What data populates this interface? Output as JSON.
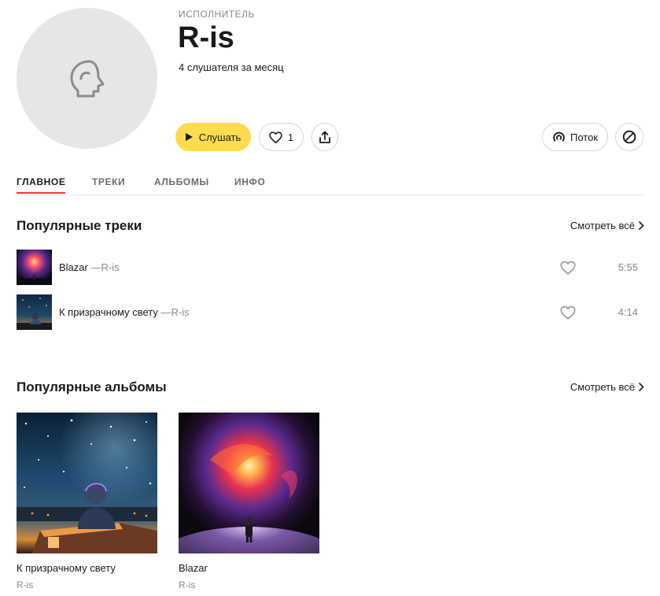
{
  "artist": {
    "kind": "ИСПОЛНИТЕЛЬ",
    "name": "R-is",
    "listeners": "4 слушателя за месяц",
    "avatar_icon": "artist-placeholder-icon"
  },
  "actions": {
    "play_label": "Слушать",
    "like_count": "1",
    "wave_label": "Поток",
    "accent_color": "#ffdb4d"
  },
  "tabs": [
    {
      "label": "ГЛАВНОЕ",
      "active": true
    },
    {
      "label": "ТРЕКИ",
      "active": false
    },
    {
      "label": "АЛЬБОМЫ",
      "active": false
    },
    {
      "label": "ИНФО",
      "active": false
    }
  ],
  "popular_tracks": {
    "title": "Популярные треки",
    "see_all": "Смотреть всё",
    "items": [
      {
        "title": "Blazar",
        "separator": "—",
        "artist": "R-is",
        "duration": "5:55"
      },
      {
        "title": "К призрачному свету",
        "separator": "—",
        "artist": "R-is",
        "duration": "4:14"
      }
    ]
  },
  "popular_albums": {
    "title": "Популярные альбомы",
    "see_all": "Смотреть всё",
    "items": [
      {
        "title": "К призрачному свету",
        "artist": "R-is"
      },
      {
        "title": "Blazar",
        "artist": "R-is"
      }
    ]
  }
}
